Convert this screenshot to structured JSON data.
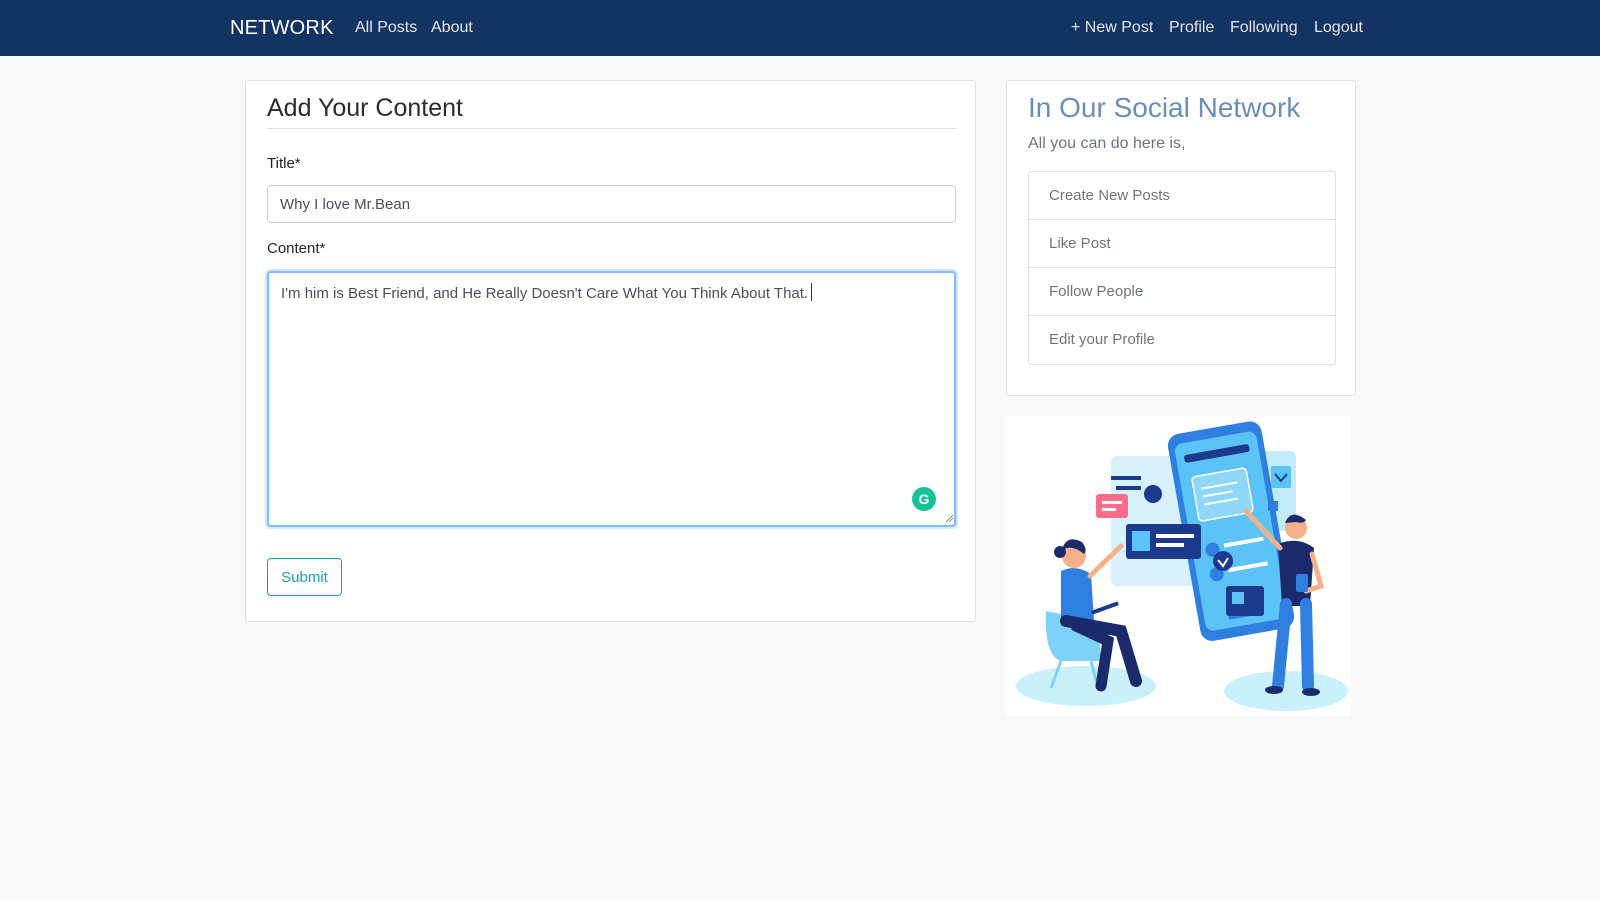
{
  "navbar": {
    "brand": "NETWORK",
    "left_links": [
      "All Posts",
      "About"
    ],
    "right_links": [
      "+ New Post",
      "Profile",
      "Following",
      "Logout"
    ]
  },
  "form": {
    "heading": "Add Your Content",
    "title_label": "Title*",
    "title_value": "Why I love Mr.Bean",
    "content_label": "Content*",
    "content_value": "I'm him is Best Friend, and He Really Doesn't Care What You Think About That.",
    "submit_label": "Submit",
    "grammarly_icon": "G"
  },
  "sidebar": {
    "title": "In Our Social Network",
    "subtitle": "All you can do here is,",
    "items": [
      "Create New Posts",
      "Like Post",
      "Follow People",
      "Edit your Profile"
    ]
  },
  "colors": {
    "navbar": "#133463",
    "accent": "#17a2b8",
    "sidebar_title": "#6a8fb4"
  }
}
